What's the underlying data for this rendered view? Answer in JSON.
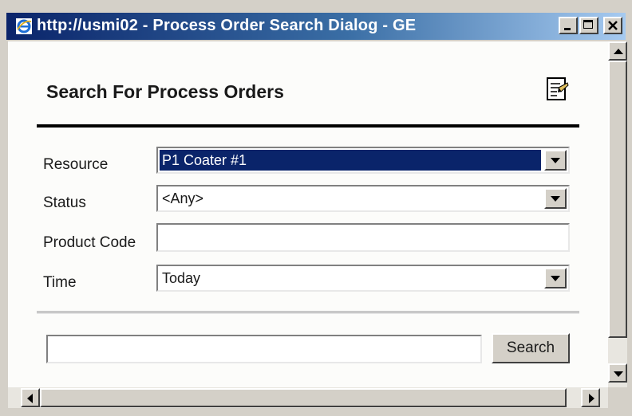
{
  "window": {
    "title": "http://usmi02 - Process Order Search Dialog - GE"
  },
  "page": {
    "heading": "Search For Process Orders"
  },
  "form": {
    "resource": {
      "label": "Resource",
      "value": "P1 Coater #1"
    },
    "status": {
      "label": "Status",
      "value": "<Any>"
    },
    "product_code": {
      "label": "Product Code",
      "value": ""
    },
    "time": {
      "label": "Time",
      "value": "Today"
    }
  },
  "search": {
    "value": "",
    "button_label": "Search"
  },
  "icons": {
    "title": "ie-icon",
    "report": "report-icon",
    "minimize": "minimize-icon",
    "maximize": "maximize-icon",
    "close": "close-icon"
  },
  "colors": {
    "titlebar": "#0a246a",
    "selection": "#0a246a",
    "chrome": "#d4d0c8"
  }
}
